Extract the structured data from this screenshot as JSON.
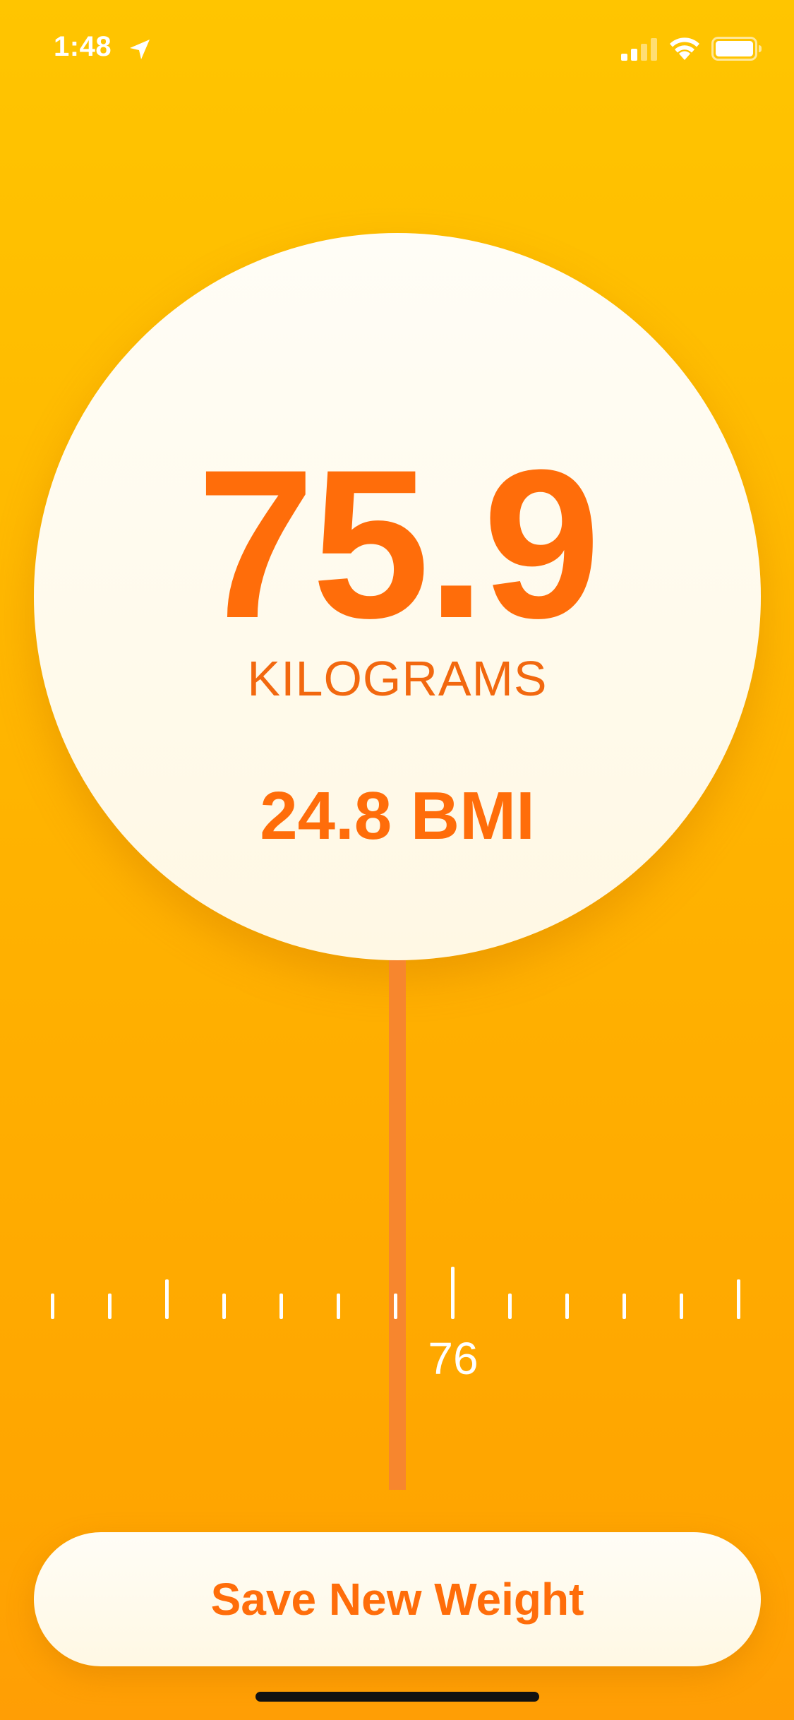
{
  "status_bar": {
    "time": "1:48",
    "icons": [
      "location-arrow-icon",
      "cellular-signal-icon",
      "wifi-icon",
      "battery-icon"
    ]
  },
  "weight": {
    "value": "75.9",
    "unit": "KILOGRAMS",
    "bmi": "24.8 BMI"
  },
  "ruler": {
    "label": "76",
    "tick_count": 13
  },
  "save_button": {
    "label": "Save New Weight"
  },
  "colors": {
    "background_top": "#ffc500",
    "background_bottom": "#ffa500",
    "accent": "#ff6d0a",
    "needle": "#f7862e",
    "card": "#fffaec"
  }
}
